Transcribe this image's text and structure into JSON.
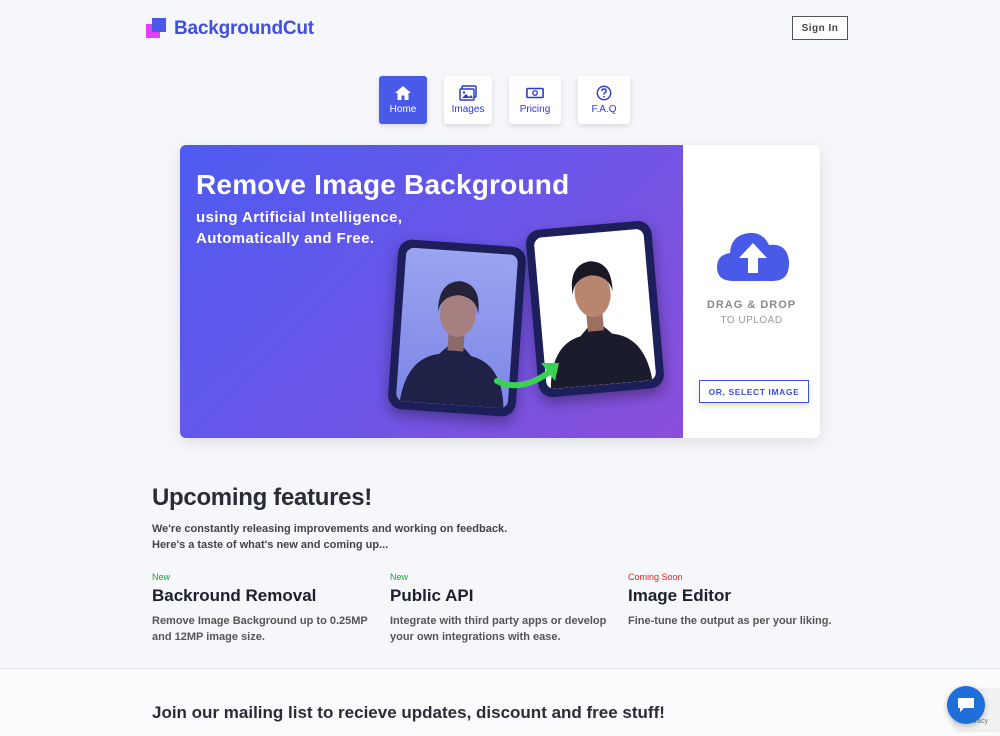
{
  "header": {
    "logo_text": "BackgroundCut",
    "signin_label": "Sign In"
  },
  "nav": {
    "items": [
      {
        "label": "Home",
        "icon": "home-icon",
        "active": true
      },
      {
        "label": "Images",
        "icon": "images-icon",
        "active": false
      },
      {
        "label": "Pricing",
        "icon": "money-icon",
        "active": false
      },
      {
        "label": "F.A.Q",
        "icon": "question-icon",
        "active": false
      }
    ]
  },
  "hero": {
    "title": "Remove Image Background",
    "subtitle_line1": "using Artificial Intelligence,",
    "subtitle_line2": "Automatically and Free.",
    "drag_drop": "DRAG & DROP",
    "to_upload": "TO UPLOAD",
    "select_button": "OR, SELECT IMAGE"
  },
  "features": {
    "title": "Upcoming features!",
    "desc_line1": "We're constantly releasing improvements and working on feedback.",
    "desc_line2": "Here's a taste of what's new and coming up...",
    "cards": [
      {
        "badge": "New",
        "title": "Backround Removal",
        "line1": "Remove Image Background up to 0.25MP",
        "line2": "and 12MP image size."
      },
      {
        "badge": "New",
        "title": "Public API",
        "line1": "Integrate with third party apps or develop",
        "line2": "your own integrations with ease."
      },
      {
        "badge": "Coming Soon",
        "title": "Image Editor",
        "line1": "Fine-tune the output as per your liking.",
        "line2": ""
      }
    ]
  },
  "mailing": {
    "title": "Join our mailing list to recieve updates, discount and free stuff!"
  },
  "recaptcha": {
    "text": "Privacy"
  },
  "colors": {
    "accent": "#4a5ae8",
    "new": "#1aa533",
    "soon": "#e02424"
  }
}
